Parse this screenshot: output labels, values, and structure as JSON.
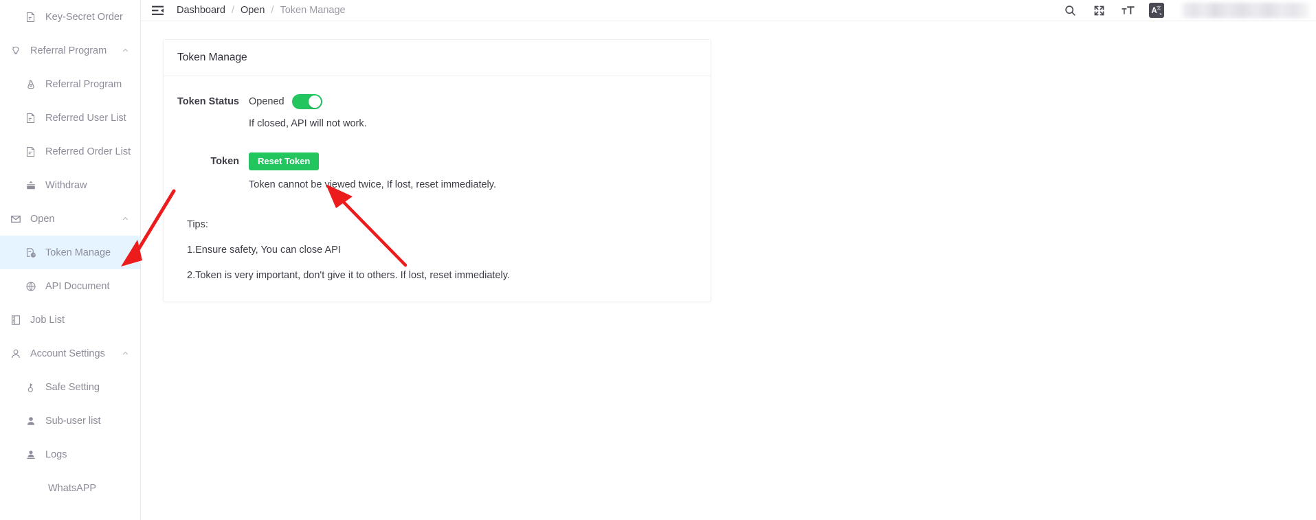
{
  "sidebar": {
    "items": [
      {
        "label": "Key-Secret Order",
        "icon": "order-doc-icon",
        "level": 2,
        "selected": false,
        "expandable": false
      },
      {
        "label": "Referral Program",
        "icon": "referral-icon",
        "level": 1,
        "selected": false,
        "expandable": true,
        "expanded": true
      },
      {
        "label": "Referral Program",
        "icon": "referral-bag-icon",
        "level": 2,
        "selected": false,
        "expandable": false
      },
      {
        "label": "Referred User List",
        "icon": "order-doc-icon",
        "level": 2,
        "selected": false,
        "expandable": false
      },
      {
        "label": "Referred Order List",
        "icon": "order-doc-icon",
        "level": 2,
        "selected": false,
        "expandable": false
      },
      {
        "label": "Withdraw",
        "icon": "withdraw-icon",
        "level": 2,
        "selected": false,
        "expandable": false
      },
      {
        "label": "Open",
        "icon": "mail-icon",
        "level": 1,
        "selected": false,
        "expandable": true,
        "expanded": true
      },
      {
        "label": "Token Manage",
        "icon": "token-manage-icon",
        "level": 2,
        "selected": true,
        "expandable": false
      },
      {
        "label": "API Document",
        "icon": "globe-icon",
        "level": 2,
        "selected": false,
        "expandable": false
      },
      {
        "label": "Job List",
        "icon": "job-list-icon",
        "level": 1,
        "selected": false,
        "expandable": false
      },
      {
        "label": "Account Settings",
        "icon": "user-outline-icon",
        "level": 1,
        "selected": false,
        "expandable": true,
        "expanded": true
      },
      {
        "label": "Safe Setting",
        "icon": "key-icon",
        "level": 2,
        "selected": false,
        "expandable": false
      },
      {
        "label": "Sub-user list",
        "icon": "user-solid-icon",
        "level": 2,
        "selected": false,
        "expandable": false
      },
      {
        "label": "Logs",
        "icon": "user-log-icon",
        "level": 2,
        "selected": false,
        "expandable": false
      },
      {
        "label": "WhatsAPP",
        "icon": "none",
        "level": 3,
        "selected": false,
        "expandable": false
      }
    ]
  },
  "header": {
    "menu_fold_icon": "menu-fold-icon",
    "breadcrumb": [
      {
        "label": "Dashboard",
        "current": false
      },
      {
        "label": "Open",
        "current": false
      },
      {
        "label": "Token Manage",
        "current": true
      }
    ],
    "separator": "/",
    "actions": [
      {
        "name": "search-icon",
        "glyph": "search"
      },
      {
        "name": "fullscreen-icon",
        "glyph": "fullscreen"
      },
      {
        "name": "font-size-icon",
        "glyph": "font-size"
      },
      {
        "name": "translate-icon",
        "glyph": "translate"
      }
    ],
    "user_area_label": ""
  },
  "card": {
    "title": "Token Manage",
    "token_status": {
      "label": "Token Status",
      "value_text": "Opened",
      "switch_on": true,
      "hint": "If closed, API will not work."
    },
    "token": {
      "label": "Token",
      "button_label": "Reset Token",
      "hint": "Token cannot be viewed twice, If lost, reset immediately."
    },
    "tips": {
      "heading": "Tips:",
      "lines": [
        "1.Ensure safety, You can close API",
        "2.Token is very important, don't give it to others. If lost, reset immediately."
      ]
    }
  },
  "colors": {
    "accent_green": "#22c55e",
    "selected_nav_bg": "#e6f4ff",
    "annotation_red": "#ec1c1c",
    "text_primary": "#3d3d47",
    "text_muted": "#8c8c9a"
  }
}
